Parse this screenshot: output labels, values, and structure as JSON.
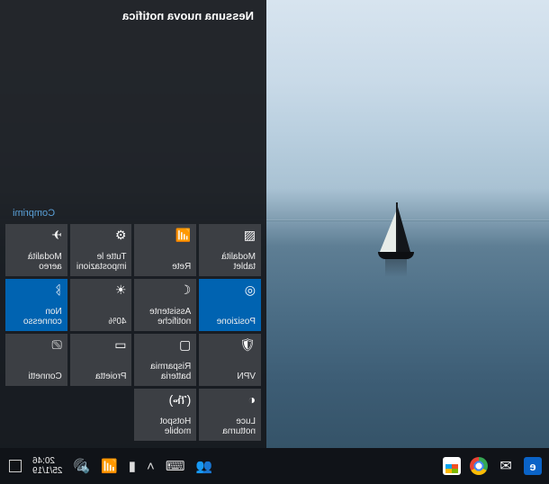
{
  "action_center": {
    "header": "Nessuna nuova notifica",
    "collapse_label": "Comprimi",
    "tiles": [
      {
        "id": "tablet-mode",
        "label": "Modalità tablet",
        "icon": "▧",
        "active": false
      },
      {
        "id": "network",
        "label": "Rete",
        "icon": "📶",
        "active": false
      },
      {
        "id": "all-settings",
        "label": "Tutte le impostazioni",
        "icon": "⚙",
        "active": false
      },
      {
        "id": "airplane-mode",
        "label": "Modalità aereo",
        "icon": "✈",
        "active": false
      },
      {
        "id": "location",
        "label": "Posizione",
        "icon": "◎",
        "active": true
      },
      {
        "id": "focus-assist",
        "label": "Assistente notifiche",
        "icon": "☾",
        "active": false
      },
      {
        "id": "brightness",
        "label": "40%",
        "icon": "☀",
        "active": false
      },
      {
        "id": "bluetooth",
        "label": "Non connesso",
        "icon": "ᛒ",
        "active": true
      },
      {
        "id": "vpn",
        "label": "VPN",
        "icon": "🛡",
        "active": false
      },
      {
        "id": "battery-saver",
        "label": "Risparmia batteria",
        "icon": "▢",
        "active": false
      },
      {
        "id": "project",
        "label": "Proietta",
        "icon": "▭",
        "active": false
      },
      {
        "id": "connect",
        "label": "Connetti",
        "icon": "⎚",
        "active": false
      },
      {
        "id": "night-light",
        "label": "Luce notturna",
        "icon": "◐",
        "active": false
      },
      {
        "id": "mobile-hotspot",
        "label": "Hotspot mobile",
        "icon": "(ዀ)",
        "active": false
      },
      {
        "id": "empty-1",
        "label": "",
        "icon": "",
        "active": false,
        "empty": true
      },
      {
        "id": "empty-2",
        "label": "",
        "icon": "",
        "active": false,
        "empty": true
      }
    ]
  },
  "taskbar": {
    "tray_icons": [
      "people-icon",
      "keyboard-icon",
      "chevron-up-icon",
      "battery-icon",
      "wifi-icon",
      "volume-icon",
      "language-icon"
    ],
    "clock": {
      "time": "20:46",
      "date": "25/1/19"
    },
    "pinned": [
      "edge",
      "mail",
      "chrome",
      "store"
    ]
  }
}
